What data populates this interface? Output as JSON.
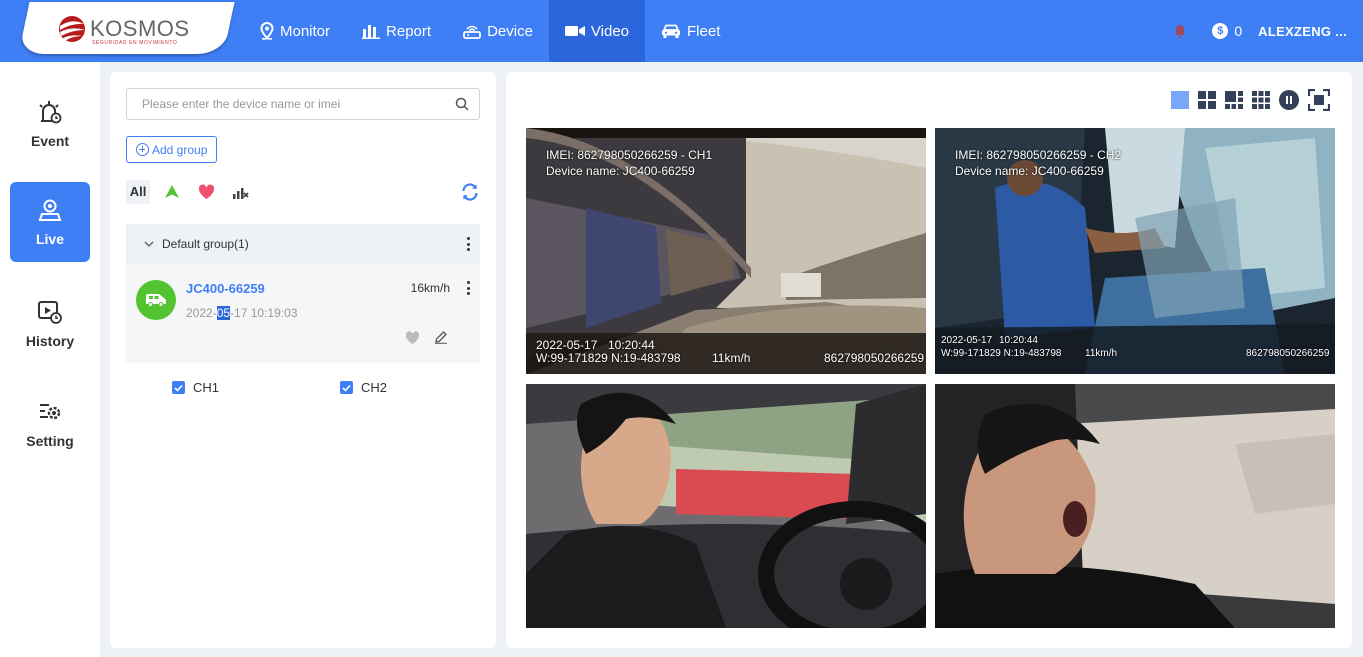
{
  "header": {
    "brand": "KOSMOS",
    "brand_tagline": "SEGURIDAD EN MOVIMIENTO",
    "nav": [
      {
        "label": "Monitor",
        "icon": "map-pin-icon"
      },
      {
        "label": "Report",
        "icon": "bar-chart-icon"
      },
      {
        "label": "Device",
        "icon": "router-icon"
      },
      {
        "label": "Video",
        "icon": "video-camera-icon",
        "active": true
      },
      {
        "label": "Fleet",
        "icon": "car-icon"
      }
    ],
    "balance": "0",
    "user": "ALEXZENG ..."
  },
  "sidebar": {
    "items": [
      {
        "label": "Event",
        "icon": "event-alarm-icon"
      },
      {
        "label": "Live",
        "icon": "live-location-icon",
        "active": true
      },
      {
        "label": "History",
        "icon": "history-playback-icon"
      },
      {
        "label": "Setting",
        "icon": "settings-icon"
      }
    ]
  },
  "devices": {
    "search_placeholder": "Please enter the device name or imei",
    "add_group_label": "Add group",
    "filter_all": "All",
    "group": {
      "name": "Default group(1)"
    },
    "device": {
      "name": "JC400-66259",
      "time_prefix": "2022-",
      "time_highlight": "05",
      "time_suffix": "-17 10:19:03",
      "speed": "16km/h"
    },
    "channels": [
      {
        "label": "CH1",
        "checked": true
      },
      {
        "label": "CH2",
        "checked": true
      }
    ]
  },
  "video": {
    "layouts": [
      "single-view-icon",
      "quad-view-icon",
      "six-view-icon",
      "nine-view-icon",
      "pause-icon",
      "fullscreen-icon"
    ],
    "tiles": [
      {
        "imei_line": "IMEI: 862798050266259 - CH1",
        "device_line": "Device name: JC400-66259",
        "osd_date": "2022-05-17",
        "osd_time": "10:20:44",
        "osd_coords": "W:99-171829  N:19-483798",
        "osd_speed": "11km/h",
        "osd_imei": "862798050266259"
      },
      {
        "imei_line": "IMEI: 862798050266259 - CH2",
        "device_line": "Device name: JC400-66259",
        "osd_date": "2022-05-17",
        "osd_time": "10:20:44",
        "osd_coords": "W:99-171829  N:19-483798",
        "osd_speed": "11km/h",
        "osd_imei": "862798050266259"
      }
    ]
  },
  "colors": {
    "primary": "#3f7ff5",
    "nav_active": "#2b66dc",
    "online": "#53c331",
    "favorite": "#f0506e"
  }
}
